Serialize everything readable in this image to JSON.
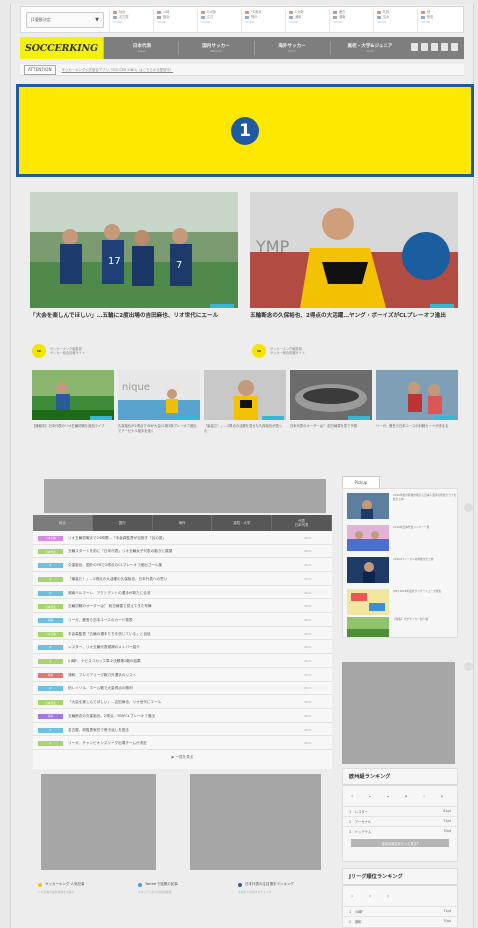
{
  "ticker": {
    "select_label": "J1優勝決定",
    "columns": [
      {
        "a": "仙台",
        "b": "名古屋",
        "time": "13:00"
      },
      {
        "a": "川崎",
        "b": "横浜",
        "time": "13:00"
      },
      {
        "a": "G大阪",
        "b": "広島",
        "time": "13:00"
      },
      {
        "a": "FC東京",
        "b": "神戸",
        "time": "13:00"
      },
      {
        "a": "C大阪",
        "b": "浦和",
        "time": "13:00"
      },
      {
        "a": "鹿島",
        "b": "湘南",
        "time": "13:00"
      },
      {
        "a": "札幌",
        "b": "清水",
        "time": "13:00"
      },
      {
        "a": "柏",
        "b": "磐田",
        "time": "13:00"
      }
    ]
  },
  "nav": {
    "logo": "SOCCERKING",
    "items": [
      {
        "label": "日本代表",
        "sub": "Japan"
      },
      {
        "label": "国内サッカー",
        "sub": "National"
      },
      {
        "label": "海外サッカー",
        "sub": "World"
      },
      {
        "label": "高校・大学&ジュニア",
        "sub": "Youth"
      }
    ]
  },
  "attention": {
    "label": "ATTENTION",
    "text": "サッカーキング公式総合アプリ「SOCCER KING」はこちらから配信中！"
  },
  "ad": {
    "number": "1"
  },
  "heroes": [
    {
      "caption": "「大会を楽しんでほしい」…五輪に2度出場の吉田麻也、リオ世代にエール",
      "author": "サッカーキング編集部",
      "author_sub": "サッカー総合情報サイト"
    },
    {
      "caption": "五輪断念の久保裕也、2得点の大活躍…ヤング・ボーイズがCLプレーオフ進出",
      "author": "サッカーキング編集部",
      "author_sub": "サッカー総合情報サイト"
    }
  ],
  "thumbs": [
    {
      "caption": "【速報中】日本代表のリオ五輪初戦を追加ライブ"
    },
    {
      "caption": "久保裕也が2得点でYBが大会CL第3節プレーオフ進出でアーセナル相手を強く"
    },
    {
      "caption": "「最高だ！」…2得点の活躍を見せた久保裕也が語った"
    },
    {
      "caption": "日本代表のオーダーは？ 前日練習を見て予想"
    },
    {
      "caption": "リーガ、鹿島ら日本ユースの対戦カードが決まる"
    }
  ],
  "news": {
    "headers": [
      {
        "l1": "総合",
        "l2": ""
      },
      {
        "l1": "国内",
        "l2": ""
      },
      {
        "l1": "海外",
        "l2": ""
      },
      {
        "l1": "高校・大学",
        "l2": ""
      },
      {
        "l1": "代表",
        "l2": "日本代表"
      }
    ],
    "rows": [
      {
        "tag": "リオ五輪",
        "title": "リオ五輪初戦まで24時間…「手倉森監督が目指す「谷の夏」",
        "date": "08/04"
      },
      {
        "tag": "日本代表",
        "title": "五輪スタートを前に「日本代表」リオ五輪女子代表の動きと展望",
        "date": "08/04"
      },
      {
        "tag": "J1",
        "title": "久保裕也、国外のYBで2得点のCLプレーオフ進出ゴール集",
        "date": "08/04"
      },
      {
        "tag": "J1",
        "title": "「最高だ！」…2得点の大活躍の久保裕也、日本代表への思い",
        "date": "08/04"
      },
      {
        "tag": "J2",
        "title": "湘南ベルマーレ、アクシデントの選手が新たに合流",
        "date": "08/04"
      },
      {
        "tag": "日本代表",
        "title": "五輪初戦のオーダーは？ 前日練習で見えてきた布陣",
        "date": "08/04"
      },
      {
        "tag": "海外",
        "title": "リーガ、鹿島ら日本ユースのカード発表",
        "date": "08/04"
      },
      {
        "tag": "リオ五輪",
        "title": "手倉森監督「五輪の選手たちを信じている」と自信",
        "date": "08/04"
      },
      {
        "tag": "J1",
        "title": "レスター、リオ五輪代表候補のメンバー紹介",
        "date": "08/04"
      },
      {
        "tag": "J1",
        "title": "川崎F、ナビスコカップ準々決勝第2戦の結果",
        "date": "08/04"
      },
      {
        "tag": "海外",
        "title": "浦和、プレミアリーグ戦力外選手のリスト",
        "date": "08/04"
      },
      {
        "tag": "J2",
        "title": "柏レイソル、ホーム戦で大量得点の勝利",
        "date": "08/04"
      },
      {
        "tag": "日本代表",
        "title": "「大会を楽しんでほしい」…吉田麻也、リオ世代にエール",
        "date": "08/04"
      },
      {
        "tag": "海外",
        "title": "五輪断念の久保裕也、2得点…YBがCLプレーオフ進出",
        "date": "08/04"
      },
      {
        "tag": "J1",
        "title": "名古屋、新監督就任で巻き返しを図る",
        "date": "08/04"
      },
      {
        "tag": "J1",
        "title": "リーガ、チャンピオンズリーグ出場チームが決定",
        "date": "08/04"
      }
    ],
    "more": "一覧を見る"
  },
  "sidebar": {
    "pickup_title": "Pickup",
    "pickups": [
      {
        "text": "2016年夏の移籍市場から日本人選手の所属クラブを総まとめ"
      },
      {
        "text": "2016年日本代表メンバー一覧"
      },
      {
        "text": "2016/17シーズン海外組全まとめ"
      },
      {
        "text": "[PR] 2016年最新サッカーシューズ特集"
      },
      {
        "text": "【特集】大学サッカー新人戦"
      }
    ],
    "rank1_title": "欧州組ランキング",
    "rank1_rows": [
      {
        "pos": "1",
        "name": "レスター",
        "pts": "81pt"
      },
      {
        "pos": "2",
        "name": "アーセナル",
        "pts": "71pt"
      },
      {
        "pos": "3",
        "name": "トッテナム",
        "pts": "70pt"
      }
    ],
    "rank1_btn": "全試合順位をもっと見る",
    "rank2_title": "Jリーグ順位ランキング",
    "rank2_tabs": [
      "J1",
      "J2",
      "J3"
    ],
    "rank2_rows": [
      {
        "pos": "1",
        "name": "川崎F",
        "pts": "71pt"
      },
      {
        "pos": "2",
        "name": "浦和",
        "pts": "70pt"
      },
      {
        "pos": "3",
        "name": "鹿島",
        "pts": "59pt"
      }
    ]
  },
  "bottom": [
    {
      "title": "サッカーキング 人気記事",
      "body": "リオ五輪の最新情報をお届け"
    },
    {
      "title": "Twitterで話題の記事",
      "body": "スタジアムからの最新投稿"
    },
    {
      "title": "日本代表の注目選手ランキング",
      "body": "今週の人気選手をチェック"
    }
  ]
}
